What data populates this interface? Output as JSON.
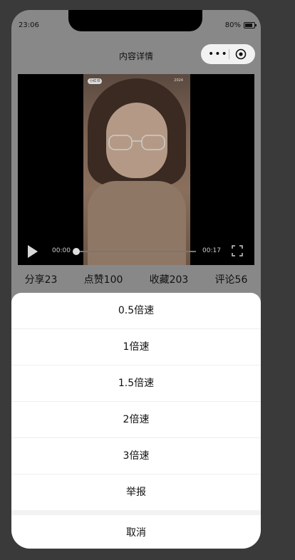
{
  "status": {
    "time": "23:06",
    "battery": "80%"
  },
  "nav": {
    "title": "内容详情",
    "more_icon": "more-dots-icon",
    "close_icon": "target-circle-icon"
  },
  "video": {
    "current_time": "00:00",
    "duration": "00:17",
    "progress": 0,
    "overlay_left": "小红书",
    "overlay_right": "2024"
  },
  "stats": [
    {
      "label": "分享23"
    },
    {
      "label": "点赞100"
    },
    {
      "label": "收藏203"
    },
    {
      "label": "评论56"
    }
  ],
  "sheet": {
    "options": [
      "0.5倍速",
      "1倍速",
      "1.5倍速",
      "2倍速",
      "3倍速",
      "举报"
    ],
    "cancel": "取消"
  }
}
